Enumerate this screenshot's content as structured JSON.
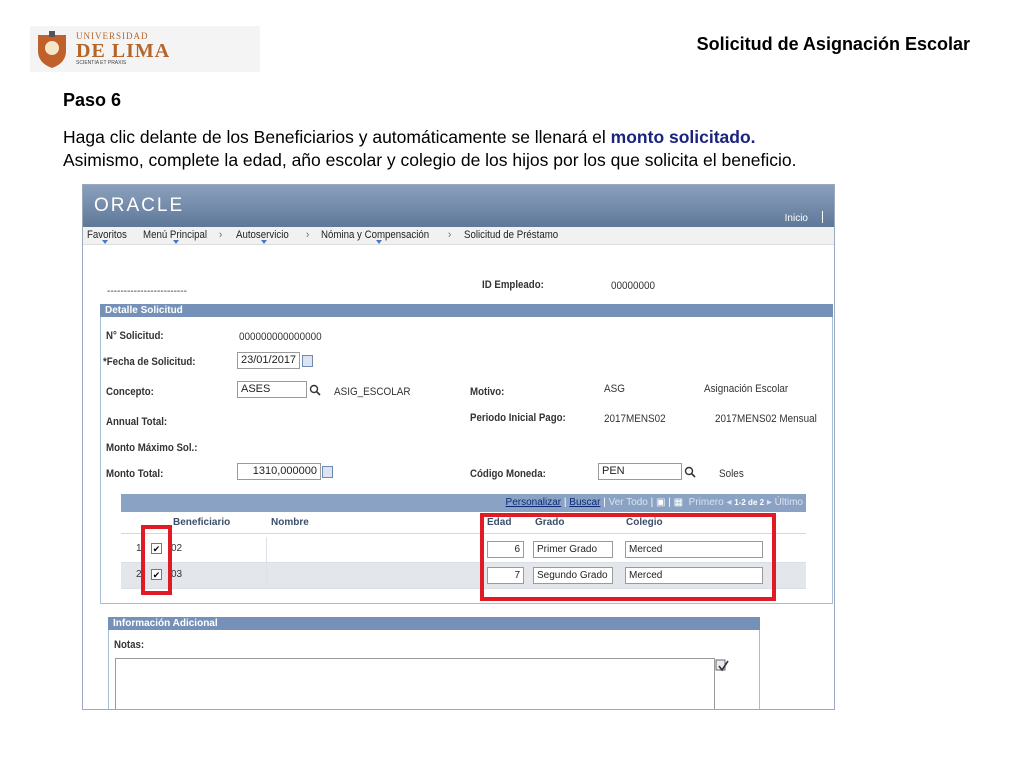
{
  "slide": {
    "logo": {
      "top": "UNIVERSIDAD",
      "main": "DE LIMA",
      "sub": "SCIENTIA ET PRAXIS"
    },
    "title": "Solicitud de Asignación Escolar",
    "step": "Paso 6",
    "instruction_part1": "Haga clic delante de los Beneficiarios y automáticamente se llenará el ",
    "instruction_highlight": "monto solicitado.",
    "instruction_line2": "Asimismo, complete la edad, año escolar y colegio de los hijos por los que solicita el beneficio."
  },
  "app": {
    "brand": "ORACLE",
    "home_link": "Inicio",
    "nav": [
      "Favoritos",
      "Menú Principal",
      "Autoservicio",
      "Nómina y Compensación",
      "Solicitud de Préstamo"
    ],
    "dashes": "------------------------",
    "employee_id_label": "ID Empleado:",
    "employee_id_value": "00000000",
    "detail_section": "Detalle Solicitud",
    "fields": {
      "request_no_label": "N° Solicitud:",
      "request_no_value": "000000000000000",
      "date_label": "*Fecha de Solicitud:",
      "date_value": "23/01/2017",
      "concept_label": "Concepto:",
      "concept_value": "ASES",
      "concept_desc": "ASIG_ESCOLAR",
      "motive_label": "Motivo:",
      "motive_code": "ASG",
      "motive_desc": "Asignación Escolar",
      "annual_total_label": "Annual Total:",
      "period_label": "Periodo Inicial Pago:",
      "period_code": "2017MENS02",
      "period_desc": "2017MENS02 Mensual",
      "max_amount_label": "Monto Máximo Sol.:",
      "total_label": "Monto Total:",
      "total_value": "1310,000000",
      "currency_label": "Código Moneda:",
      "currency_value": "PEN",
      "currency_desc": "Soles"
    },
    "grid": {
      "toolbar": {
        "personalize": "Personalizar",
        "search": "Buscar",
        "view_all": "Ver Todo",
        "first": "Primero",
        "range": "1-2 de 2",
        "last": "Último"
      },
      "columns": [
        "Beneficiario",
        "Nombre",
        "Edad",
        "Grado",
        "Colegio"
      ],
      "rows": [
        {
          "n": "1",
          "checked": "✔",
          "beneficiary": "02",
          "name": "",
          "age": "6",
          "grade": "Primer Grado",
          "school": "Merced"
        },
        {
          "n": "2",
          "checked": "✔",
          "beneficiary": "03",
          "name": "",
          "age": "7",
          "grade": "Segundo Grado",
          "school": "Merced"
        }
      ]
    },
    "additional_section": "Información Adicional",
    "notes_label": "Notas:"
  },
  "colors": {
    "highlight_text": "#1a237e",
    "annotation_red": "#e01b24",
    "section_bar": "#7591b8",
    "brand_bar": "#6f87a8"
  }
}
